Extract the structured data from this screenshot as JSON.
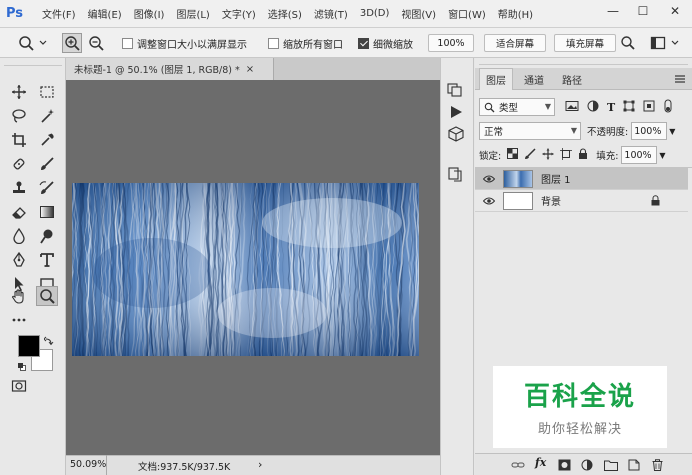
{
  "app": {
    "logo": "Ps"
  },
  "menu": [
    "文件(F)",
    "编辑(E)",
    "图像(I)",
    "图层(L)",
    "文字(Y)",
    "选择(S)",
    "滤镜(T)",
    "3D(D)",
    "视图(V)",
    "窗口(W)",
    "帮助(H)"
  ],
  "window_controls": {
    "minimize": "—",
    "maximize": "☐",
    "close": "✕"
  },
  "options_bar": {
    "resize_windows_label": "调整窗口大小以满屏显示",
    "resize_windows_checked": false,
    "zoom_all_windows_label": "缩放所有窗口",
    "zoom_all_windows_checked": false,
    "scrubby_zoom_label": "细微缩放",
    "scrubby_zoom_checked": true,
    "zoom_value": "100%",
    "fit_screen_label": "适合屏幕",
    "fill_screen_label": "填充屏幕"
  },
  "document": {
    "tab_title": "未标题-1 @ 50.1% (图层 1, RGB/8) *",
    "tab_close": "×"
  },
  "status": {
    "zoom": "50.09%",
    "doc_info": "文档:937.5K/937.5K",
    "arrow": "›"
  },
  "layers_panel": {
    "tabs": [
      "图层",
      "通道",
      "路径"
    ],
    "active_tab": "图层",
    "filter_label": "类型",
    "blend_mode": "正常",
    "opacity_label": "不透明度:",
    "opacity_value": "100%",
    "lock_label": "锁定:",
    "fill_label": "填充:",
    "fill_value": "100%",
    "layers": [
      {
        "name": "图层 1",
        "active": true,
        "locked": false
      },
      {
        "name": "背景",
        "active": false,
        "locked": true
      }
    ]
  },
  "watermark": {
    "title": "百科全说",
    "subtitle": "助你轻松解决"
  },
  "colors": {
    "accent": "#2f6ad1",
    "canvas_bg": "#6c6c6c",
    "watermark_green": "#1aa24a"
  }
}
